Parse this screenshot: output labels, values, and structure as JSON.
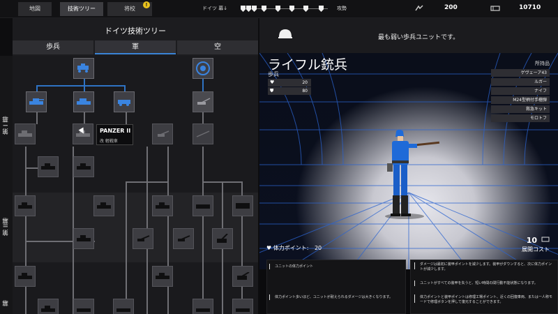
{
  "tabs": [
    {
      "label": "地図"
    },
    {
      "label": "技術ツリー"
    },
    {
      "label": "将校",
      "badge": "!"
    }
  ],
  "front": {
    "left_label": "ドイツ 幕↓",
    "right_label": "攻勢"
  },
  "resources": {
    "manpower": "200",
    "munitions": "10710"
  },
  "tree": {
    "title": "ドイツ技術ツリー",
    "branches": [
      "歩兵",
      "軍",
      "空"
    ],
    "selected_branch": "軍",
    "eras": [
      "第 I 幕",
      "第 II幕",
      "幕"
    ],
    "tooltip": {
      "name": "PANZER II",
      "sub": "改 軽戦車"
    }
  },
  "unit": {
    "description": "最も弱い歩兵ユニットです。",
    "name": "ライフル銃兵",
    "class": "歩兵",
    "stats": [
      {
        "icon": "heart-icon",
        "value": "20"
      },
      {
        "icon": "shield-icon",
        "value": "80"
      }
    ],
    "inventory_title": "所持品",
    "inventory": [
      "ゲヴェーア43",
      "ルガー",
      "ナイフ",
      "M24型柄付手榴弾",
      "救急キット",
      "モロトフ"
    ],
    "deploy_cost": "10",
    "deploy_label": "展開コスト",
    "hp_label": "体力ポイント:",
    "hp_value": "20"
  },
  "info": {
    "left": [
      "ユニットの体力ポイント",
      "体力ポイント多いほど、ユニットが耐えられるダメージは大きくなります。"
    ],
    "right": [
      "ダメージは最初に装甲ポイントを減少します。装甲がダウンすると、次に体力ポイントが減少します。",
      "ユニットがすべての装甲を失うと、短い時間の間行動不能状態になります。",
      "体力ポイントと装甲ポイントは修理工場ポイント、近くの回復車両、または一人称モードで修理ボタンを押して復元することができます。"
    ]
  },
  "colors": {
    "accent": "#2f73c4",
    "panel": "#1c1c1f",
    "badge": "#e9c21d"
  }
}
